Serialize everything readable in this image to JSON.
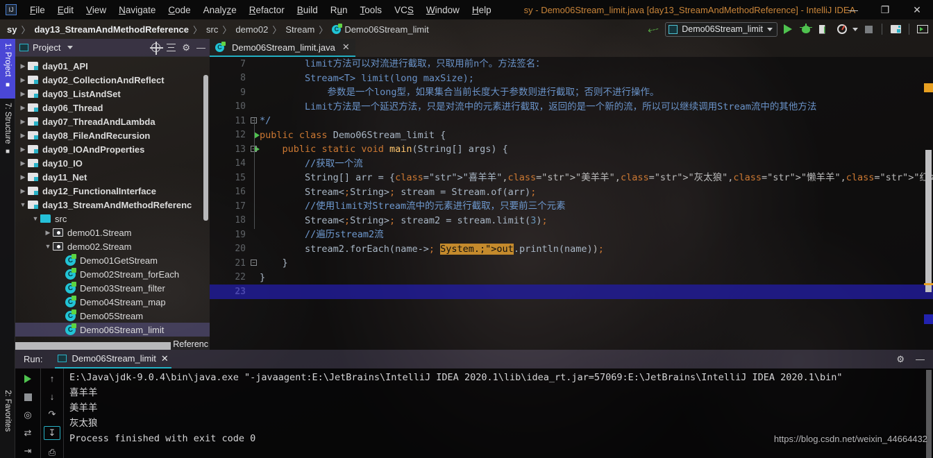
{
  "window": {
    "title": "sy - Demo06Stream_limit.java [day13_StreamAndMethodReference] - IntelliJ IDEA",
    "logo": "IJ",
    "minimize": "—",
    "restore": "❐",
    "close": "✕"
  },
  "menu": [
    {
      "label": "File"
    },
    {
      "label": "Edit"
    },
    {
      "label": "View"
    },
    {
      "label": "Navigate"
    },
    {
      "label": "Code"
    },
    {
      "label": "Analyze"
    },
    {
      "label": "Refactor"
    },
    {
      "label": "Build"
    },
    {
      "label": "Run"
    },
    {
      "label": "Tools"
    },
    {
      "label": "VCS"
    },
    {
      "label": "Window"
    },
    {
      "label": "Help"
    }
  ],
  "breadcrumb": {
    "sep": "〉",
    "items": [
      {
        "label": "sy"
      },
      {
        "label": "day13_StreamAndMethodReference"
      },
      {
        "label": "src"
      },
      {
        "label": "demo02"
      },
      {
        "label": "Stream"
      },
      {
        "label": "Demo06Stream_limit"
      }
    ]
  },
  "toolbar": {
    "run_config": "Demo06Stream_limit",
    "build_icon": "build-hammer-icon",
    "run_icon": "run-icon",
    "debug_icon": "debug-icon",
    "coverage_icon": "run-with-coverage-icon",
    "profiler_icon": "profiler-icon",
    "stop_icon": "stop-icon",
    "project_structure_icon": "project-structure-icon",
    "search_everywhere_icon": "screen-icon"
  },
  "left_strip": [
    {
      "label": "1: Project",
      "active": true
    },
    {
      "label": "7: Structure",
      "active": false
    }
  ],
  "left_strip_bottom": [
    {
      "label": "2: Favorites"
    }
  ],
  "project_panel": {
    "title": "Project",
    "caret": "▼",
    "tools": [
      "locate-icon",
      "collapse-all-icon",
      "settings-gear-icon",
      "hide-icon"
    ],
    "ghost_text": "Referenc",
    "tree": [
      {
        "label": "day01_API",
        "type": "module",
        "indent": 0,
        "arrow": "▶",
        "bold": true
      },
      {
        "label": "day02_CollectionAndReflect",
        "type": "module",
        "indent": 0,
        "arrow": "▶",
        "bold": true
      },
      {
        "label": "day03_ListAndSet",
        "type": "module",
        "indent": 0,
        "arrow": "▶",
        "bold": true
      },
      {
        "label": "day06_Thread",
        "type": "module",
        "indent": 0,
        "arrow": "▶",
        "bold": true
      },
      {
        "label": "day07_ThreadAndLambda",
        "type": "module",
        "indent": 0,
        "arrow": "▶",
        "bold": true
      },
      {
        "label": "day08_FileAndRecursion",
        "type": "module",
        "indent": 0,
        "arrow": "▶",
        "bold": true
      },
      {
        "label": "day09_IOAndProperties",
        "type": "module",
        "indent": 0,
        "arrow": "▶",
        "bold": true
      },
      {
        "label": "day10_IO",
        "type": "module",
        "indent": 0,
        "arrow": "▶",
        "bold": true
      },
      {
        "label": "day11_Net",
        "type": "module",
        "indent": 0,
        "arrow": "▶",
        "bold": true
      },
      {
        "label": "day12_FunctionalInterface",
        "type": "module",
        "indent": 0,
        "arrow": "▶",
        "bold": true
      },
      {
        "label": "day13_StreamAndMethodReferenc",
        "type": "module",
        "indent": 0,
        "arrow": "▼",
        "bold": true
      },
      {
        "label": "src",
        "type": "source",
        "indent": 1,
        "arrow": "▼",
        "bold": false
      },
      {
        "label": "demo01.Stream",
        "type": "package",
        "indent": 2,
        "arrow": "▶",
        "bold": false
      },
      {
        "label": "demo02.Stream",
        "type": "package",
        "indent": 2,
        "arrow": "▼",
        "bold": false
      },
      {
        "label": "Demo01GetStream",
        "type": "class",
        "indent": 3,
        "arrow": "",
        "bold": false
      },
      {
        "label": "Demo02Stream_forEach",
        "type": "class",
        "indent": 3,
        "arrow": "",
        "bold": false
      },
      {
        "label": "Demo03Stream_filter",
        "type": "class",
        "indent": 3,
        "arrow": "",
        "bold": false
      },
      {
        "label": "Demo04Stream_map",
        "type": "class",
        "indent": 3,
        "arrow": "",
        "bold": false
      },
      {
        "label": "Demo05Stream",
        "type": "class",
        "indent": 3,
        "arrow": "",
        "bold": false
      },
      {
        "label": "Demo06Stream_limit",
        "type": "class",
        "indent": 3,
        "arrow": "",
        "bold": false,
        "selected": true
      }
    ]
  },
  "editor": {
    "tab": {
      "label": "Demo06Stream_limit.java",
      "close": "✕"
    },
    "first_line_number": 7,
    "current_line": 23,
    "lines": [
      {
        "n": 7,
        "run": false,
        "fold": "",
        "text": "        limit方法可以对流进行截取，只取用前n个。方法签名："
      },
      {
        "n": 8,
        "run": false,
        "fold": "",
        "text": "        Stream<T> limit(long maxSize);"
      },
      {
        "n": 9,
        "run": false,
        "fold": "",
        "text": "            参数是一个long型，如果集合当前长度大于参数则进行截取；否则不进行操作。"
      },
      {
        "n": 10,
        "run": false,
        "fold": "",
        "text": "        Limit方法是一个延迟方法，只是对流中的元素进行截取，返回的是一个新的流，所以可以继续调用Stream流中的其他方法"
      },
      {
        "n": 11,
        "run": false,
        "fold": "−",
        "text": "*/"
      },
      {
        "n": 12,
        "run": true,
        "fold": "",
        "text": "public class Demo06Stream_limit {"
      },
      {
        "n": 13,
        "run": true,
        "fold": "−",
        "text": "    public static void main(String[] args) {"
      },
      {
        "n": 14,
        "run": false,
        "fold": "",
        "text": "        //获取一个流"
      },
      {
        "n": 15,
        "run": false,
        "fold": "",
        "text": "        String[] arr = {\"喜羊羊\",\"美羊羊\",\"灰太狼\",\"懒羊羊\",\"红太狼\"};"
      },
      {
        "n": 16,
        "run": false,
        "fold": "",
        "text": "        Stream<String> stream = Stream.of(arr);"
      },
      {
        "n": 17,
        "run": false,
        "fold": "",
        "text": "        //使用limit对Stream流中的元素进行截取，只要前三个元素"
      },
      {
        "n": 18,
        "run": false,
        "fold": "",
        "text": "        Stream<String> stream2 = stream.limit(3);"
      },
      {
        "n": 19,
        "run": false,
        "fold": "",
        "text": "        //遍历stream2流"
      },
      {
        "n": 20,
        "run": false,
        "fold": "",
        "text": "        stream2.forEach(name-> System.out.println(name));"
      },
      {
        "n": 21,
        "run": false,
        "fold": "−",
        "text": "    }"
      },
      {
        "n": 22,
        "run": false,
        "fold": "",
        "text": "}"
      },
      {
        "n": 23,
        "run": false,
        "fold": "",
        "text": ""
      }
    ]
  },
  "run_panel": {
    "label": "Run:",
    "tab": "Demo06Stream_limit",
    "tab_close": "✕",
    "settings_icon": "settings-gear-icon",
    "hide_icon": "hide-icon",
    "tools_left": [
      "rerun-icon",
      "stop-icon",
      "dump-threads-icon",
      "restore-layout-icon",
      "exit-icon"
    ],
    "tools_right": [
      "scroll-up-icon",
      "scroll-down-icon",
      "soft-wrap-icon",
      "scroll-to-end-icon",
      "print-icon"
    ],
    "console": [
      "E:\\Java\\jdk-9.0.4\\bin\\java.exe \"-javaagent:E:\\JetBrains\\IntelliJ IDEA 2020.1\\lib\\idea_rt.jar=57069:E:\\JetBrains\\IntelliJ IDEA 2020.1\\bin\"",
      "喜羊羊",
      "美羊羊",
      "灰太狼",
      "",
      "Process finished with exit code 0"
    ]
  },
  "watermark": "https://blog.csdn.net/weixin_44664432",
  "colors": {
    "accent": "#23b0c4",
    "run_green": "#4fc24f",
    "title_orange": "#c9853a",
    "highlight_blue": "#211ca0",
    "selection_gold": "#c48a2c"
  }
}
